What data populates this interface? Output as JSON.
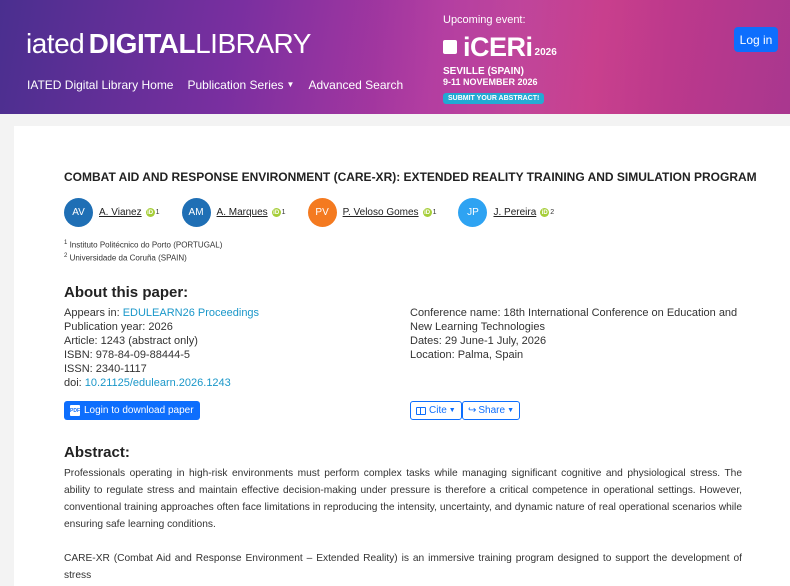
{
  "header": {
    "brand_prefix": "iated",
    "brand_bold": "DIGITAL",
    "brand_light": "LIBRARY",
    "nav": [
      "IATED Digital Library Home",
      "Publication Series",
      "Advanced Search"
    ],
    "event": {
      "upcoming": "Upcoming event:",
      "name": "iCERi",
      "year": "2026",
      "location": "SEVILLE (SPAIN)",
      "dates": "9-11 NOVEMBER 2026",
      "submit": "SUBMIT YOUR ABSTRACT!"
    },
    "login": "Log in"
  },
  "paper": {
    "title": "COMBAT AID AND RESPONSE ENVIRONMENT (CARE-XR): EXTENDED REALITY TRAINING AND SIMULATION PROGRAM",
    "authors": [
      {
        "initials": "AV",
        "name": "A. Vianez",
        "aff": "1",
        "color": "#1f6fb5"
      },
      {
        "initials": "AM",
        "name": "A. Marques",
        "aff": "1",
        "color": "#1f6fb5"
      },
      {
        "initials": "PV",
        "name": "P. Veloso Gomes",
        "aff": "1",
        "color": "#f47a20"
      },
      {
        "initials": "JP",
        "name": "J. Pereira",
        "aff": "2",
        "color": "#2ea3f2"
      }
    ],
    "affiliations": [
      {
        "num": "1",
        "text": "Instituto Politécnico do Porto (PORTUGAL)"
      },
      {
        "num": "2",
        "text": "Universidade da Coruña (SPAIN)"
      }
    ],
    "about_heading": "About this paper:",
    "meta_left": {
      "appears_label": "Appears in: ",
      "appears_value": "EDULEARN26 Proceedings",
      "year": "Publication year: 2026",
      "article": "Article: 1243 (abstract only)",
      "isbn": "ISBN: 978-84-09-88444-5",
      "issn": "ISSN: 2340-1117",
      "doi_label": "doi: ",
      "doi_value": "10.21125/edulearn.2026.1243"
    },
    "meta_right": {
      "conference": "Conference name: 18th International Conference on Education and New Learning Technologies",
      "dates": "Dates: 29 June-1 July, 2026",
      "location": "Location: Palma, Spain"
    },
    "download_button": "Login to download paper",
    "cite_button": "Cite",
    "share_button": "Share",
    "abstract_heading": "Abstract:",
    "abstract_p1": "Professionals operating in high-risk environments must perform complex tasks while managing significant cognitive and physiological stress. The ability to regulate stress and maintain effective decision-making under pressure is therefore a critical competence in operational settings. However, conventional training approaches often face limitations in reproducing the intensity, uncertainty, and dynamic nature of real operational scenarios while ensuring safe learning conditions.",
    "abstract_p2": "CARE-XR (Combat Aid and Response Environment – Extended Reality) is an immersive training program designed to support the development of stress"
  }
}
